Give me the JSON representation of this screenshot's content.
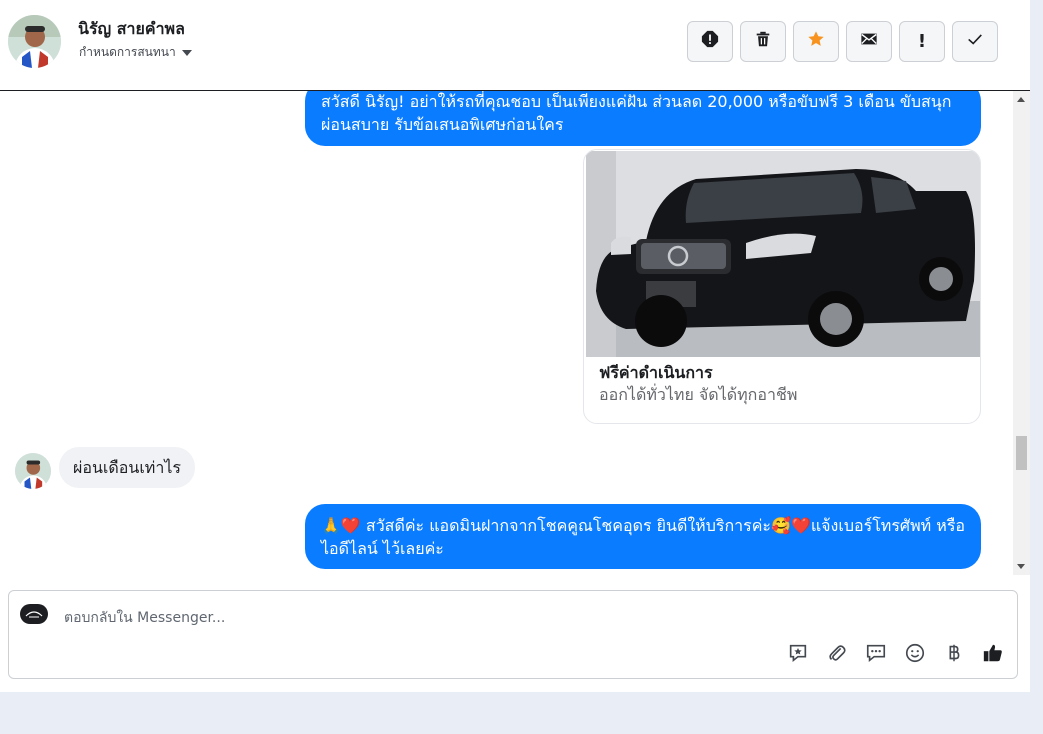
{
  "header": {
    "contact_name": "นิรัญ สายคำพล",
    "subtitle": "กำหนดการสนทนา",
    "actions": [
      {
        "name": "report-icon",
        "label": "!"
      },
      {
        "name": "delete-icon",
        "label": ""
      },
      {
        "name": "star-icon",
        "label": ""
      },
      {
        "name": "mail-icon",
        "label": ""
      },
      {
        "name": "important-icon",
        "label": "!"
      },
      {
        "name": "check-icon",
        "label": ""
      }
    ]
  },
  "messages": {
    "m1": {
      "text": "สวัสดี นิรัญ! อย่าให้รถที่คุณชอบ เป็นเพียงแค่ฝัน ส่วนลด 20,000 หรือขับฟรี 3 เดือน ขับสนุก ผ่อนสบาย รับข้อเสนอพิเศษก่อนใคร"
    },
    "card": {
      "title": "ฟรีค่าดำเนินการ",
      "subtitle": "ออกได้ทั่วไทย จัดได้ทุกอาชีพ"
    },
    "m2": {
      "text": "ผ่อนเดือนเท่าไร"
    },
    "m3": {
      "text": "🙏❤️ สวัสดีค่ะ แอดมินฝากจากโชคคูณโชคอุดร ยินดีให้บริการค่ะ🥰❤️แจ้งเบอร์โทรศัพท์ หรือ ไอดีไลน์  ไว้เลยค่ะ"
    }
  },
  "composer": {
    "placeholder": "ตอบกลับใน Messenger...",
    "tools": [
      "saved-reply-icon",
      "attachment-icon",
      "chat-icon",
      "emoji-icon",
      "baht-icon",
      "like-icon"
    ]
  },
  "colors": {
    "accent": "#0a7cff",
    "star": "#f7931e"
  }
}
